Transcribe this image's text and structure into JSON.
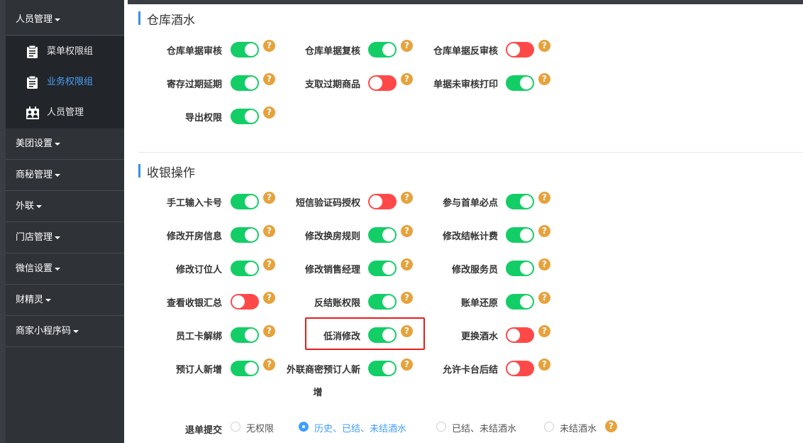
{
  "sidebar": {
    "menu": [
      {
        "label": "人员管理"
      },
      {
        "label": "美团设置"
      },
      {
        "label": "商秘管理"
      },
      {
        "label": "外联"
      },
      {
        "label": "门店管理"
      },
      {
        "label": "微信设置"
      },
      {
        "label": "财精灵"
      },
      {
        "label": "商家小程序码"
      }
    ],
    "submenu": [
      {
        "label": "菜单权限组",
        "icon": "clipboard-icon"
      },
      {
        "label": "业务权限组",
        "icon": "clipboard-icon",
        "active": true
      },
      {
        "label": "人员管理",
        "icon": "people-icon"
      }
    ]
  },
  "sections": [
    {
      "title": "仓库酒水"
    },
    {
      "title": "收银操作"
    }
  ],
  "warehouse": [
    {
      "label": "仓库单据审核",
      "on": true
    },
    {
      "label": "仓库单据复核",
      "on": true
    },
    {
      "label": "仓库单据反审核",
      "on": false
    },
    {
      "label": "寄存过期延期",
      "on": true
    },
    {
      "label": "支取过期商品",
      "on": false
    },
    {
      "label": "单据未审核打印",
      "on": true
    },
    {
      "label": "导出权限",
      "on": true
    }
  ],
  "cashier": [
    {
      "label": "手工输入卡号",
      "on": true
    },
    {
      "label": "短信验证码授权",
      "on": false
    },
    {
      "label": "参与首单必点",
      "on": true
    },
    {
      "label": "修改开房信息",
      "on": true
    },
    {
      "label": "修改换房规则",
      "on": true
    },
    {
      "label": "修改结帐计费",
      "on": true
    },
    {
      "label": "修改订位人",
      "on": true
    },
    {
      "label": "修改销售经理",
      "on": true
    },
    {
      "label": "修改服务员",
      "on": true
    },
    {
      "label": "查看收银汇总",
      "on": false
    },
    {
      "label": "反结账权限",
      "on": true
    },
    {
      "label": "账单还原",
      "on": true
    },
    {
      "label": "员工卡解绑",
      "on": true
    },
    {
      "label": "低消修改",
      "on": true
    },
    {
      "label": "更换酒水",
      "on": false
    },
    {
      "label": "预订人新增",
      "on": true
    },
    {
      "label": "外联商密预订人新",
      "label2": "增",
      "on": true
    },
    {
      "label": "允许卡台后结",
      "on": false
    }
  ],
  "refund": {
    "label": "退单提交",
    "options": [
      "无权限",
      "历史、已结、未结酒水",
      "已结、未结酒水",
      "未结酒水"
    ],
    "selected": 1
  },
  "help_symbol": "?",
  "colors": {
    "on": "#13ce66",
    "off": "#ff4949",
    "accent": "#409eff",
    "highlight": "#e81d1d"
  }
}
